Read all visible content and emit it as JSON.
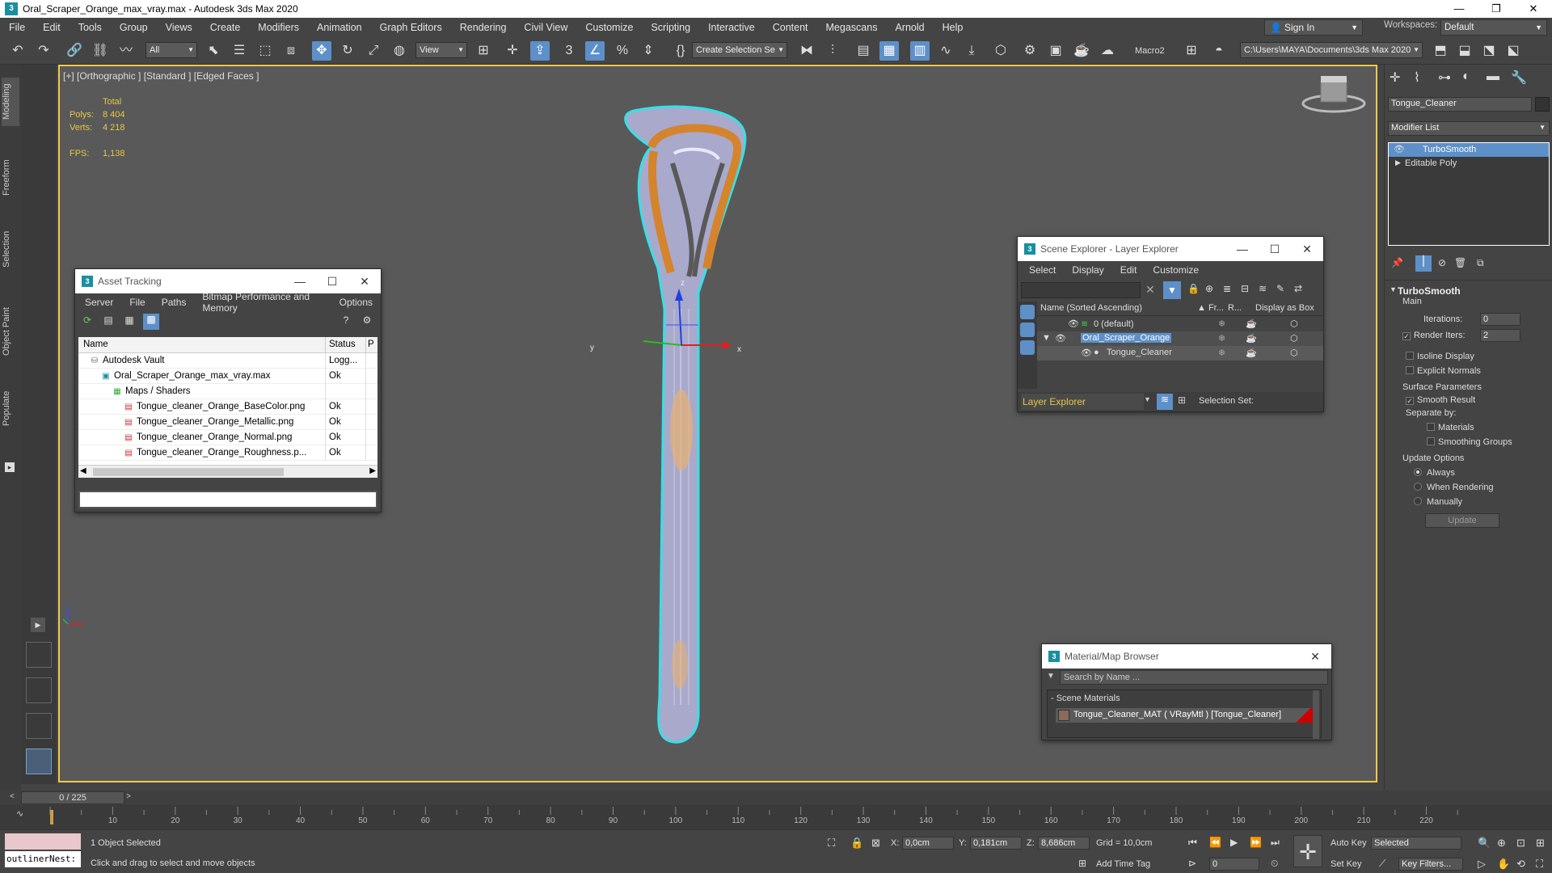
{
  "title_bar": {
    "app_icon": "3ds-max-logo",
    "title": "Oral_Scraper_Orange_max_vray.max - Autodesk 3ds Max 2020",
    "buttons": [
      "minimize",
      "restore",
      "close"
    ]
  },
  "menu": [
    "File",
    "Edit",
    "Tools",
    "Group",
    "Views",
    "Create",
    "Modifiers",
    "Animation",
    "Graph Editors",
    "Rendering",
    "Civil View",
    "Customize",
    "Scripting",
    "Interactive",
    "Content",
    "Megascans",
    "Arnold",
    "Help"
  ],
  "signin": {
    "label": "Sign In"
  },
  "workspaces": {
    "label": "Workspaces:",
    "value": "Default"
  },
  "toolbar": {
    "filter_select": "All",
    "refcoord_select": "View",
    "selection_set": "Create Selection Se",
    "macro": "Macro2",
    "project_path": "C:\\Users\\MAYA\\Documents\\3ds Max 2020"
  },
  "left_tabs": [
    "Modeling",
    "Freeform",
    "Selection",
    "Object Paint",
    "Populate"
  ],
  "viewport": {
    "label": "[+] [Orthographic ] [Standard ] [Edged Faces ]",
    "stats_header": "Total",
    "polys_label": "Polys:",
    "polys_value": "8 404",
    "verts_label": "Verts:",
    "verts_value": "4 218",
    "fps_label": "FPS:",
    "fps_value": "1,138",
    "gizmo_x": "x",
    "gizmo_y": "y",
    "gizmo_z": "z"
  },
  "asset_tracking": {
    "title": "Asset Tracking",
    "menu": [
      "Server",
      "File",
      "Paths",
      "Bitmap Performance and Memory",
      "Options"
    ],
    "columns": [
      "Name",
      "Status",
      "P"
    ],
    "rows": [
      {
        "name": "Autodesk Vault",
        "status": "Logg...",
        "indent": 1,
        "icon": "vault-icon"
      },
      {
        "name": "Oral_Scraper_Orange_max_vray.max",
        "status": "Ok",
        "indent": 2,
        "icon": "max-file-icon"
      },
      {
        "name": "Maps / Shaders",
        "status": "",
        "indent": 3,
        "icon": "maps-icon"
      },
      {
        "name": "Tongue_cleaner_Orange_BaseColor.png",
        "status": "Ok",
        "indent": 4,
        "icon": "image-file-icon"
      },
      {
        "name": "Tongue_cleaner_Orange_Metallic.png",
        "status": "Ok",
        "indent": 4,
        "icon": "image-file-icon"
      },
      {
        "name": "Tongue_cleaner_Orange_Normal.png",
        "status": "Ok",
        "indent": 4,
        "icon": "image-file-icon"
      },
      {
        "name": "Tongue_cleaner_Orange_Roughness.p...",
        "status": "Ok",
        "indent": 4,
        "icon": "image-file-icon"
      }
    ]
  },
  "scene_explorer": {
    "title": "Scene Explorer - Layer Explorer",
    "menu": [
      "Select",
      "Display",
      "Edit",
      "Customize"
    ],
    "columns": [
      "Name (Sorted Ascending)",
      "▲ Fr...",
      "R...",
      "Display as Box"
    ],
    "rows": [
      {
        "name": "0 (default)",
        "level": 0
      },
      {
        "name": "Oral_Scraper_Orange",
        "level": 0
      },
      {
        "name": "Tongue_Cleaner",
        "level": 1
      }
    ],
    "footer_select": "Layer Explorer",
    "selection_set_label": "Selection Set:"
  },
  "material_browser": {
    "title": "Material/Map Browser",
    "search_placeholder": "Search by Name ...",
    "group": "- Scene Materials",
    "item": "Tongue_Cleaner_MAT  ( VRayMtl )  [Tongue_Cleaner]"
  },
  "command_panel": {
    "object_name": "Tongue_Cleaner",
    "modifier_list": "Modifier List",
    "stack": [
      "TurboSmooth",
      "Editable Poly"
    ],
    "rollout_title": "TurboSmooth",
    "main_label": "Main",
    "iterations_label": "Iterations:",
    "iterations_value": "0",
    "render_iters_label": "Render Iters:",
    "render_iters_value": "2",
    "isoline_label": "Isoline Display",
    "explicit_normals_label": "Explicit Normals",
    "surface_params_label": "Surface Parameters",
    "smooth_result_label": "Smooth Result",
    "separate_by_label": "Separate by:",
    "materials_label": "Materials",
    "smoothing_groups_label": "Smoothing Groups",
    "update_options_label": "Update Options",
    "always_label": "Always",
    "when_rendering_label": "When Rendering",
    "manually_label": "Manually",
    "update_button": "Update"
  },
  "timeline": {
    "frame_label": "0 / 225",
    "ticks": [
      "10",
      "20",
      "30",
      "40",
      "50",
      "60",
      "70",
      "80",
      "90",
      "100",
      "110",
      "120",
      "130",
      "140",
      "150",
      "160",
      "170",
      "180",
      "190",
      "200",
      "210",
      "220"
    ]
  },
  "status": {
    "script_listener": "outlinerNest:",
    "selected": "1 Object Selected",
    "prompt": "Click and drag to select and move objects",
    "x_label": "X:",
    "x_value": "0,0cm",
    "y_label": "Y:",
    "y_value": "0,181cm",
    "z_label": "Z:",
    "z_value": "8,686cm",
    "grid": "Grid = 10,0cm",
    "add_time_tag": "Add Time Tag",
    "auto_key": "Auto Key",
    "set_key": "Set Key",
    "selected_select": "Selected",
    "key_filters": "Key Filters...",
    "frame_field": "0"
  }
}
